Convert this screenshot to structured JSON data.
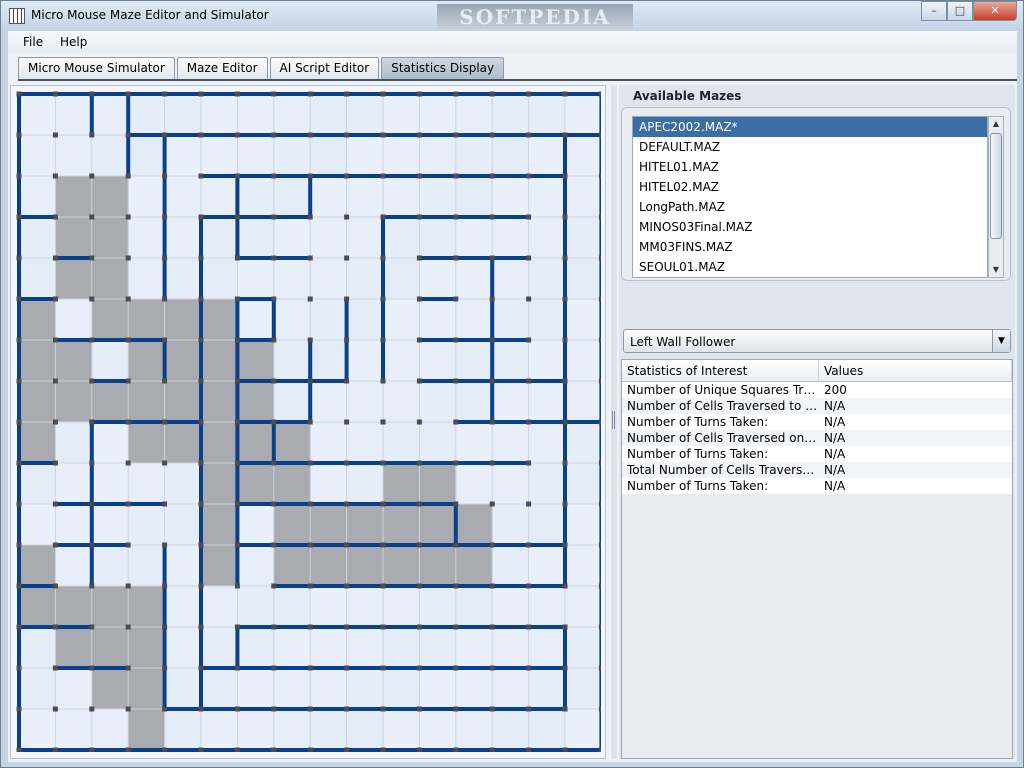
{
  "window": {
    "title": "Micro Mouse Maze Editor and Simulator",
    "watermark": "SOFTPEDIA",
    "minimize": "–",
    "maximize": "□",
    "close": "✕"
  },
  "menu": {
    "file": "File",
    "help": "Help"
  },
  "tabs": [
    {
      "label": "Micro Mouse Simulator"
    },
    {
      "label": "Maze Editor"
    },
    {
      "label": "AI Script Editor"
    },
    {
      "label": "Statistics Display"
    }
  ],
  "active_tab": "Statistics Display",
  "available_mazes": {
    "title": "Available Mazes",
    "items": [
      "APEC2002.MAZ*",
      "DEFAULT.MAZ",
      "HITEL01.MAZ",
      "HITEL02.MAZ",
      "LongPath.MAZ",
      "MINOS03Final.MAZ",
      "MM03FINS.MAZ",
      "SEOUL01.MAZ"
    ],
    "selected": "APEC2002.MAZ*"
  },
  "algorithm": {
    "selected": "Left Wall Follower"
  },
  "statistics": {
    "headers": [
      "Statistics of Interest",
      "Values"
    ],
    "rows": [
      {
        "name": "Number of Unique Squares Trav...",
        "value": "200"
      },
      {
        "name": "Number of Cells Traversed to R...",
        "value": "N/A"
      },
      {
        "name": "Number of Turns Taken:",
        "value": "N/A"
      },
      {
        "name": "Number of Cells Traversed on B...",
        "value": "N/A"
      },
      {
        "name": "Number of Turns Taken:",
        "value": "N/A"
      },
      {
        "name": "Total Number of Cells Traversed...",
        "value": "N/A"
      },
      {
        "name": "Number of Turns Taken:",
        "value": "N/A"
      }
    ]
  },
  "maze": {
    "size": 16,
    "colors": {
      "cell_light": "#eef3fb",
      "cell_blue": "#d6e1f4",
      "visited": "#a9abb1",
      "wall": "#0a3f8a",
      "post": "#4d4d4d"
    },
    "visited_cells": [
      [
        1,
        2
      ],
      [
        2,
        2
      ],
      [
        1,
        3
      ],
      [
        2,
        3
      ],
      [
        1,
        4
      ],
      [
        2,
        4
      ],
      [
        2,
        5
      ],
      [
        0,
        5
      ],
      [
        0,
        6
      ],
      [
        0,
        7
      ],
      [
        1,
        7
      ],
      [
        2,
        7
      ],
      [
        1,
        6
      ],
      [
        0,
        8
      ],
      [
        3,
        5
      ],
      [
        3,
        6
      ],
      [
        3,
        7
      ],
      [
        3,
        8
      ],
      [
        4,
        5
      ],
      [
        4,
        6
      ],
      [
        4,
        7
      ],
      [
        4,
        8
      ],
      [
        5,
        5
      ],
      [
        5,
        6
      ],
      [
        5,
        7
      ],
      [
        6,
        6
      ],
      [
        6,
        7
      ],
      [
        6,
        8
      ],
      [
        6,
        9
      ],
      [
        7,
        8
      ],
      [
        7,
        9
      ],
      [
        7,
        10
      ],
      [
        7,
        11
      ],
      [
        8,
        10
      ],
      [
        8,
        11
      ],
      [
        9,
        10
      ],
      [
        9,
        11
      ],
      [
        10,
        9
      ],
      [
        10,
        10
      ],
      [
        10,
        11
      ],
      [
        11,
        9
      ],
      [
        11,
        10
      ],
      [
        11,
        11
      ],
      [
        12,
        10
      ],
      [
        12,
        11
      ],
      [
        5,
        8
      ],
      [
        5,
        9
      ],
      [
        5,
        10
      ],
      [
        5,
        11
      ],
      [
        0,
        11
      ],
      [
        0,
        12
      ],
      [
        1,
        12
      ],
      [
        2,
        12
      ],
      [
        3,
        12
      ],
      [
        1,
        13
      ],
      [
        2,
        13
      ],
      [
        3,
        13
      ],
      [
        2,
        14
      ],
      [
        3,
        14
      ],
      [
        3,
        15
      ]
    ],
    "h_walls": [
      [
        0,
        0,
        16
      ],
      [
        1,
        3,
        16
      ],
      [
        2,
        5,
        15
      ],
      [
        3,
        0,
        1
      ],
      [
        3,
        5,
        8
      ],
      [
        3,
        10,
        14
      ],
      [
        4,
        1,
        2
      ],
      [
        4,
        6,
        8
      ],
      [
        4,
        11,
        14
      ],
      [
        5,
        0,
        1
      ],
      [
        5,
        6,
        7
      ],
      [
        5,
        11,
        12
      ],
      [
        6,
        1,
        4
      ],
      [
        6,
        6,
        7
      ],
      [
        6,
        11,
        14
      ],
      [
        7,
        2,
        3
      ],
      [
        7,
        6,
        9
      ],
      [
        7,
        11,
        15
      ],
      [
        8,
        2,
        5
      ],
      [
        8,
        6,
        8
      ],
      [
        8,
        12,
        16
      ],
      [
        9,
        0,
        1
      ],
      [
        9,
        6,
        14
      ],
      [
        10,
        1,
        4
      ],
      [
        10,
        6,
        12
      ],
      [
        11,
        1,
        3
      ],
      [
        11,
        6,
        15
      ],
      [
        12,
        0,
        1
      ],
      [
        12,
        7,
        15
      ],
      [
        13,
        0,
        2
      ],
      [
        13,
        6,
        15
      ],
      [
        14,
        1,
        3
      ],
      [
        14,
        5,
        15
      ],
      [
        15,
        4,
        15
      ],
      [
        16,
        0,
        16
      ]
    ],
    "v_walls": [
      [
        0,
        0,
        16
      ],
      [
        2,
        0,
        1
      ],
      [
        3,
        0,
        2
      ],
      [
        4,
        1,
        5
      ],
      [
        5,
        3,
        15
      ],
      [
        6,
        2,
        4
      ],
      [
        8,
        2,
        3
      ],
      [
        10,
        3,
        7
      ],
      [
        4,
        6,
        7
      ],
      [
        6,
        5,
        12
      ],
      [
        7,
        5,
        6
      ],
      [
        7,
        8,
        9
      ],
      [
        8,
        6,
        8
      ],
      [
        9,
        5,
        7
      ],
      [
        13,
        4,
        8
      ],
      [
        15,
        1,
        12
      ],
      [
        2,
        8,
        12
      ],
      [
        4,
        11,
        15
      ],
      [
        6,
        13,
        14
      ],
      [
        12,
        10,
        11
      ],
      [
        15,
        13,
        15
      ],
      [
        16,
        0,
        16
      ]
    ]
  }
}
